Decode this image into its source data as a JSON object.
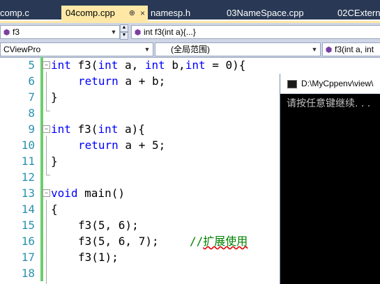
{
  "tabs": [
    {
      "label": "comp.c",
      "active": false
    },
    {
      "label": "04comp.cpp",
      "active": true
    },
    {
      "label": "namesp.h",
      "active": false
    },
    {
      "label": "03NameSpace.cpp",
      "active": false
    },
    {
      "label": "02CExtern.",
      "active": false
    }
  ],
  "tab_pin_glyph": "⊕",
  "tab_close_glyph": "×",
  "nav": {
    "symbol_combo": "f3",
    "signature_combo": "int f3(int a){...}",
    "project_combo": "CViewPro",
    "scope_combo": "(全局范围)",
    "member_combo": "f3(int a, int"
  },
  "editor": {
    "lines": [
      {
        "num": "5"
      },
      {
        "num": "6"
      },
      {
        "num": "7"
      },
      {
        "num": "8"
      },
      {
        "num": "9"
      },
      {
        "num": "10"
      },
      {
        "num": "11"
      },
      {
        "num": "12"
      },
      {
        "num": "13"
      },
      {
        "num": "14"
      },
      {
        "num": "15"
      },
      {
        "num": "16"
      },
      {
        "num": "17"
      },
      {
        "num": "18"
      }
    ],
    "code": {
      "l5_kw1": "int",
      "l5_a": " f3(",
      "l5_kw2": "int",
      "l5_b": " a, ",
      "l5_kw3": "int",
      "l5_c": " b,",
      "l5_kw4": "int",
      "l5_d": " = 0){",
      "l6_kw": "return",
      "l6_rest": " a + b;",
      "l7": "}",
      "l9_kw1": "int",
      "l9_a": " f3(",
      "l9_kw2": "int",
      "l9_b": " a){",
      "l10_kw": "return",
      "l10_rest": " a + 5;",
      "l11": "}",
      "l13_kw": "void",
      "l13_rest": " main()",
      "l14": "{",
      "l15": "f3(5, 6);",
      "l16_code": "f3(5, 6, 7);",
      "l16_comment_prefix": "//",
      "l16_comment": "扩展使用",
      "l17": "f3(1);"
    }
  },
  "console": {
    "title": "D:\\MyCppenv\\view\\",
    "output": "请按任意键继续. . ."
  },
  "colors": {
    "tabbar": "#293955",
    "active_tab": "#ffe8a6",
    "keyword": "#0000ff",
    "comment": "#008000",
    "line_number": "#2b91af",
    "change_marker": "#6ccd6c"
  }
}
